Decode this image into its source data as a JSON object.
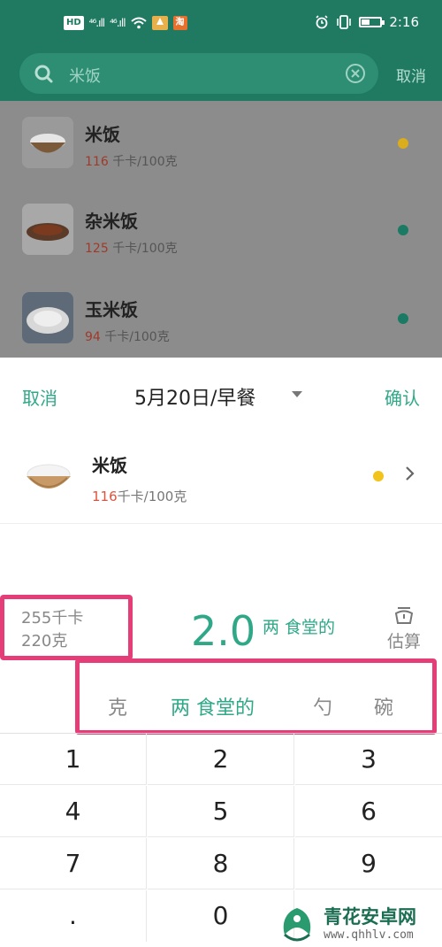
{
  "status_bar": {
    "hd_badge": "HD",
    "signal_1": "⁴⁶.ıll",
    "signal_2": "⁴⁶.ıll",
    "app_badge": "淘",
    "time": "2:16",
    "battery_level": 0.45,
    "colors": {
      "background": "#1f7a61"
    }
  },
  "search": {
    "query": "米饭",
    "cancel_label": "取消"
  },
  "food_list": [
    {
      "name": "米饭",
      "calories": "116",
      "unit": "千卡/100克",
      "dot_color": "#d9ad1b",
      "image": "rice-bowl"
    },
    {
      "name": "杂米饭",
      "calories": "125",
      "unit": "千卡/100克",
      "dot_color": "#1a7a63",
      "image": "mixed-rice-plate"
    },
    {
      "name": "玉米饭",
      "calories": "94",
      "unit": "千卡/100克",
      "dot_color": "#1a7a63",
      "image": "corn-rice-plate"
    }
  ],
  "sheet": {
    "cancel_label": "取消",
    "title": "5月20日/早餐",
    "confirm_label": "确认",
    "selected_food": {
      "name": "米饭",
      "calories": "116",
      "unit": "千卡/100克",
      "dot_color": "#f2c31b"
    },
    "summary": {
      "kcal": "255千卡",
      "grams": "220克"
    },
    "amount": {
      "value": "2.0",
      "unit": "两 食堂的"
    },
    "estimate_label": "估算",
    "unit_tabs": [
      {
        "label": "克",
        "active": false
      },
      {
        "label": "两 食堂的",
        "active": true
      },
      {
        "label": "勺",
        "active": false
      },
      {
        "label": "碗",
        "active": false
      }
    ],
    "keys": [
      "1",
      "2",
      "3",
      "4",
      "5",
      "6",
      "7",
      "8",
      "9",
      ".",
      "0",
      ""
    ]
  },
  "watermark": {
    "title": "青花安卓网",
    "url": "www.qhhlv.com"
  },
  "colors": {
    "accent": "#2fa887",
    "brand_dark": "#1f7a61",
    "calorie_red": "#e0533a",
    "highlight_box": "#e43d78"
  }
}
